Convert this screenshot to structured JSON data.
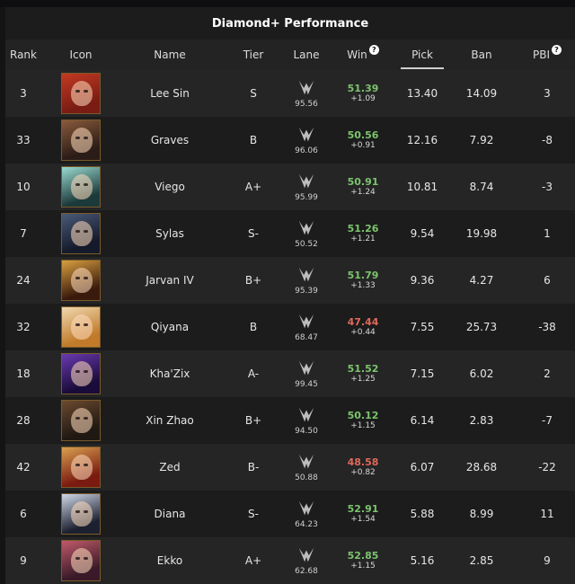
{
  "title": "Diamond+ Performance",
  "headers": {
    "rank": "Rank",
    "icon": "Icon",
    "name": "Name",
    "tier": "Tier",
    "lane": "Lane",
    "win": "Win",
    "pick": "Pick",
    "ban": "Ban",
    "pbi": "PBI"
  },
  "help_glyph": "?",
  "rows": [
    {
      "rank": "3",
      "name": "Lee Sin",
      "tier": "S",
      "lane": "95.56",
      "win": "51.39",
      "win_delta": "+1.09",
      "win_state": "up",
      "pick": "13.40",
      "ban": "14.09",
      "pbi": "3",
      "icon": "lee-sin-icon",
      "c1": "#7a1c14",
      "c2": "#c23a22"
    },
    {
      "rank": "33",
      "name": "Graves",
      "tier": "B",
      "lane": "96.06",
      "win": "50.56",
      "win_delta": "+0.91",
      "win_state": "up",
      "pick": "12.16",
      "ban": "7.92",
      "pbi": "-8",
      "icon": "graves-icon",
      "c1": "#2a1c16",
      "c2": "#8a5a3c"
    },
    {
      "rank": "10",
      "name": "Viego",
      "tier": "A+",
      "lane": "95.99",
      "win": "50.91",
      "win_delta": "+1.24",
      "win_state": "up",
      "pick": "10.81",
      "ban": "8.74",
      "pbi": "-3",
      "icon": "viego-icon",
      "c1": "#1c3a3a",
      "c2": "#9adad0"
    },
    {
      "rank": "7",
      "name": "Sylas",
      "tier": "S-",
      "lane": "50.52",
      "win": "51.26",
      "win_delta": "+1.21",
      "win_state": "up",
      "pick": "9.54",
      "ban": "19.98",
      "pbi": "1",
      "icon": "sylas-icon",
      "c1": "#141a2a",
      "c2": "#4a5a78"
    },
    {
      "rank": "24",
      "name": "Jarvan IV",
      "tier": "B+",
      "lane": "95.39",
      "win": "51.79",
      "win_delta": "+1.33",
      "win_state": "up",
      "pick": "9.36",
      "ban": "4.27",
      "pbi": "6",
      "icon": "jarvan-iv-icon",
      "c1": "#3a1a0c",
      "c2": "#d8a040"
    },
    {
      "rank": "32",
      "name": "Qiyana",
      "tier": "B",
      "lane": "68.47",
      "win": "47.44",
      "win_delta": "+0.44",
      "win_state": "down",
      "pick": "7.55",
      "ban": "25.73",
      "pbi": "-38",
      "icon": "qiyana-icon",
      "c1": "#c07a2a",
      "c2": "#f0d8b0"
    },
    {
      "rank": "18",
      "name": "Kha'Zix",
      "tier": "A-",
      "lane": "99.45",
      "win": "51.52",
      "win_delta": "+1.25",
      "win_state": "up",
      "pick": "7.15",
      "ban": "6.02",
      "pbi": "2",
      "icon": "khazix-icon",
      "c1": "#1a0c3a",
      "c2": "#6a3ab0"
    },
    {
      "rank": "28",
      "name": "Xin Zhao",
      "tier": "B+",
      "lane": "94.50",
      "win": "50.12",
      "win_delta": "+1.15",
      "win_state": "up",
      "pick": "6.14",
      "ban": "2.83",
      "pbi": "-7",
      "icon": "xin-zhao-icon",
      "c1": "#201812",
      "c2": "#6a4a30"
    },
    {
      "rank": "42",
      "name": "Zed",
      "tier": "B-",
      "lane": "50.88",
      "win": "48.58",
      "win_delta": "+0.82",
      "win_state": "down",
      "pick": "6.07",
      "ban": "28.68",
      "pbi": "-22",
      "icon": "zed-icon",
      "c1": "#7a1a10",
      "c2": "#d8a050"
    },
    {
      "rank": "6",
      "name": "Diana",
      "tier": "S-",
      "lane": "64.23",
      "win": "52.91",
      "win_delta": "+1.54",
      "win_state": "up",
      "pick": "5.88",
      "ban": "8.99",
      "pbi": "11",
      "icon": "diana-icon",
      "c1": "#1c2030",
      "c2": "#d0d8e8"
    },
    {
      "rank": "9",
      "name": "Ekko",
      "tier": "A+",
      "lane": "62.68",
      "win": "52.85",
      "win_delta": "+1.15",
      "win_state": "up",
      "pick": "5.16",
      "ban": "2.85",
      "pbi": "9",
      "icon": "ekko-icon",
      "c1": "#3a1a28",
      "c2": "#c05a6a"
    }
  ],
  "colors": {
    "win_up": "#7cc46d",
    "win_down": "#e0685a",
    "panel_bg": "#1c1c1c",
    "alt_row_bg": "#252525",
    "icon_border": "#7a5a2a"
  }
}
